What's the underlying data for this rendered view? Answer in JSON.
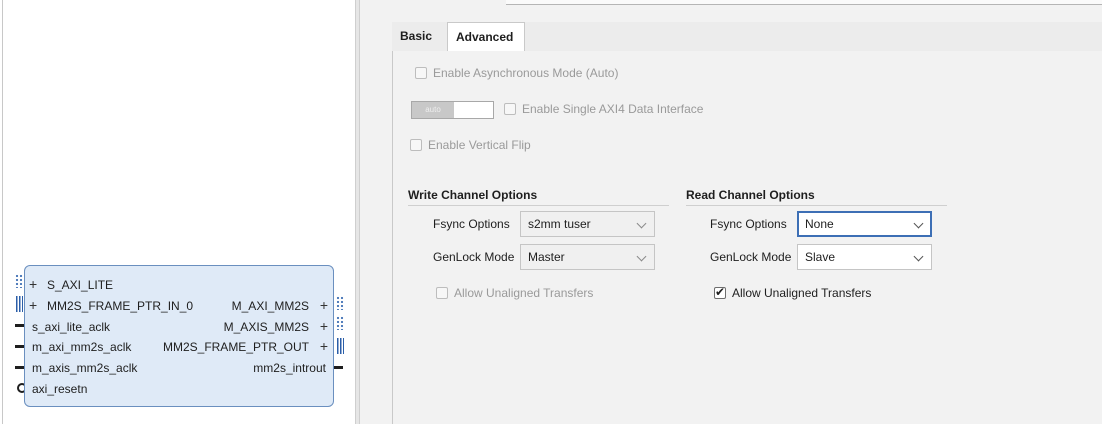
{
  "ip_block": {
    "left_ports": [
      "S_AXI_LITE",
      "MM2S_FRAME_PTR_IN_0",
      "s_axi_lite_aclk",
      "m_axi_mm2s_aclk",
      "m_axis_mm2s_aclk",
      "axi_resetn"
    ],
    "right_ports": [
      "M_AXI_MM2S",
      "M_AXIS_MM2S",
      "MM2S_FRAME_PTR_OUT",
      "mm2s_introut"
    ],
    "expand_glyph": "+",
    "border_color": "#6a8fbf",
    "fill_color": "#dfeaf7"
  },
  "tabs": {
    "basic_label": "Basic",
    "advanced_label": "Advanced",
    "active": "Advanced"
  },
  "advanced": {
    "async_mode_label": "Enable Asynchronous Mode (Auto)",
    "auto_toggle_label": "auto",
    "single_axi4_label": "Enable Single AXI4 Data Interface",
    "vertical_flip_label": "Enable Vertical Flip"
  },
  "write_channel": {
    "title": "Write Channel Options",
    "fsync_label": "Fsync Options",
    "fsync_value": "s2mm tuser",
    "genlock_label": "GenLock Mode",
    "genlock_value": "Master",
    "unaligned_label": "Allow Unaligned Transfers",
    "unaligned_checked": false
  },
  "read_channel": {
    "title": "Read Channel Options",
    "fsync_label": "Fsync Options",
    "fsync_value": "None",
    "genlock_label": "GenLock Mode",
    "genlock_value": "Slave",
    "unaligned_label": "Allow Unaligned Transfers",
    "unaligned_checked": true,
    "checkmark": "✔"
  },
  "colors": {
    "focus_border": "#3d6fb5",
    "disabled_text": "#9a9a9a",
    "panel_bg": "#f2f2f2"
  }
}
